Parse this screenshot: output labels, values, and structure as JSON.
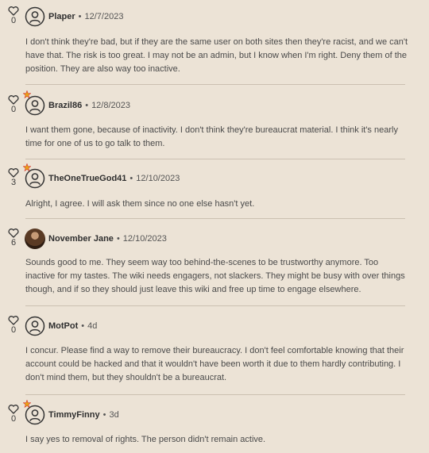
{
  "colors": {
    "background": "#ece3d6",
    "divider": "#cbc0b1",
    "moderator_star": "#e8a317",
    "moderator_star_accent": "#d6332b"
  },
  "comments": [
    {
      "likes": "0",
      "username": "Plaper",
      "time": "12/7/2023",
      "avatar": "default-avatar-icon",
      "star": false,
      "text": "I don't think they're bad, but if they are the same user on both sites then they're racist, and we can't have that. The risk is too great. I may not be an admin, but I know when I'm right. Deny them of the position. They are also way too inactive."
    },
    {
      "likes": "0",
      "username": "Brazil86",
      "time": "12/8/2023",
      "avatar": "default-avatar-icon",
      "star": true,
      "text": "I want them gone, because of inactivity. I don't think they're bureaucrat material. I think it's nearly time for one of us to go talk to them."
    },
    {
      "likes": "3",
      "username": "TheOneTrueGod41",
      "time": "12/10/2023",
      "avatar": "default-avatar-icon",
      "star": true,
      "text": "Alright, I agree. I will ask them since no one else hasn't yet."
    },
    {
      "likes": "6",
      "username": "November Jane",
      "time": "12/10/2023",
      "avatar": "photo-avatar",
      "star": false,
      "text": "Sounds good to me. They seem way too behind-the-scenes to be trustworthy anymore. Too inactive for my tastes. The wiki needs engagers, not slackers. They might be busy with over things though, and if so they should just leave this wiki and free up time to engage elsewhere."
    },
    {
      "likes": "0",
      "username": "MotPot",
      "time": "4d",
      "avatar": "default-avatar-icon",
      "star": false,
      "text": "I concur. Please find a way to remove their bureaucracy. I don't feel comfortable knowing that their account could be hacked and that it wouldn't have been worth it due to them hardly contributing. I don't mind them, but they shouldn't be a bureaucrat."
    },
    {
      "likes": "0",
      "username": "TimmyFinny",
      "time": "3d",
      "avatar": "default-avatar-icon",
      "star": true,
      "text": "I say yes to removal of rights. The person didn't remain active."
    }
  ]
}
